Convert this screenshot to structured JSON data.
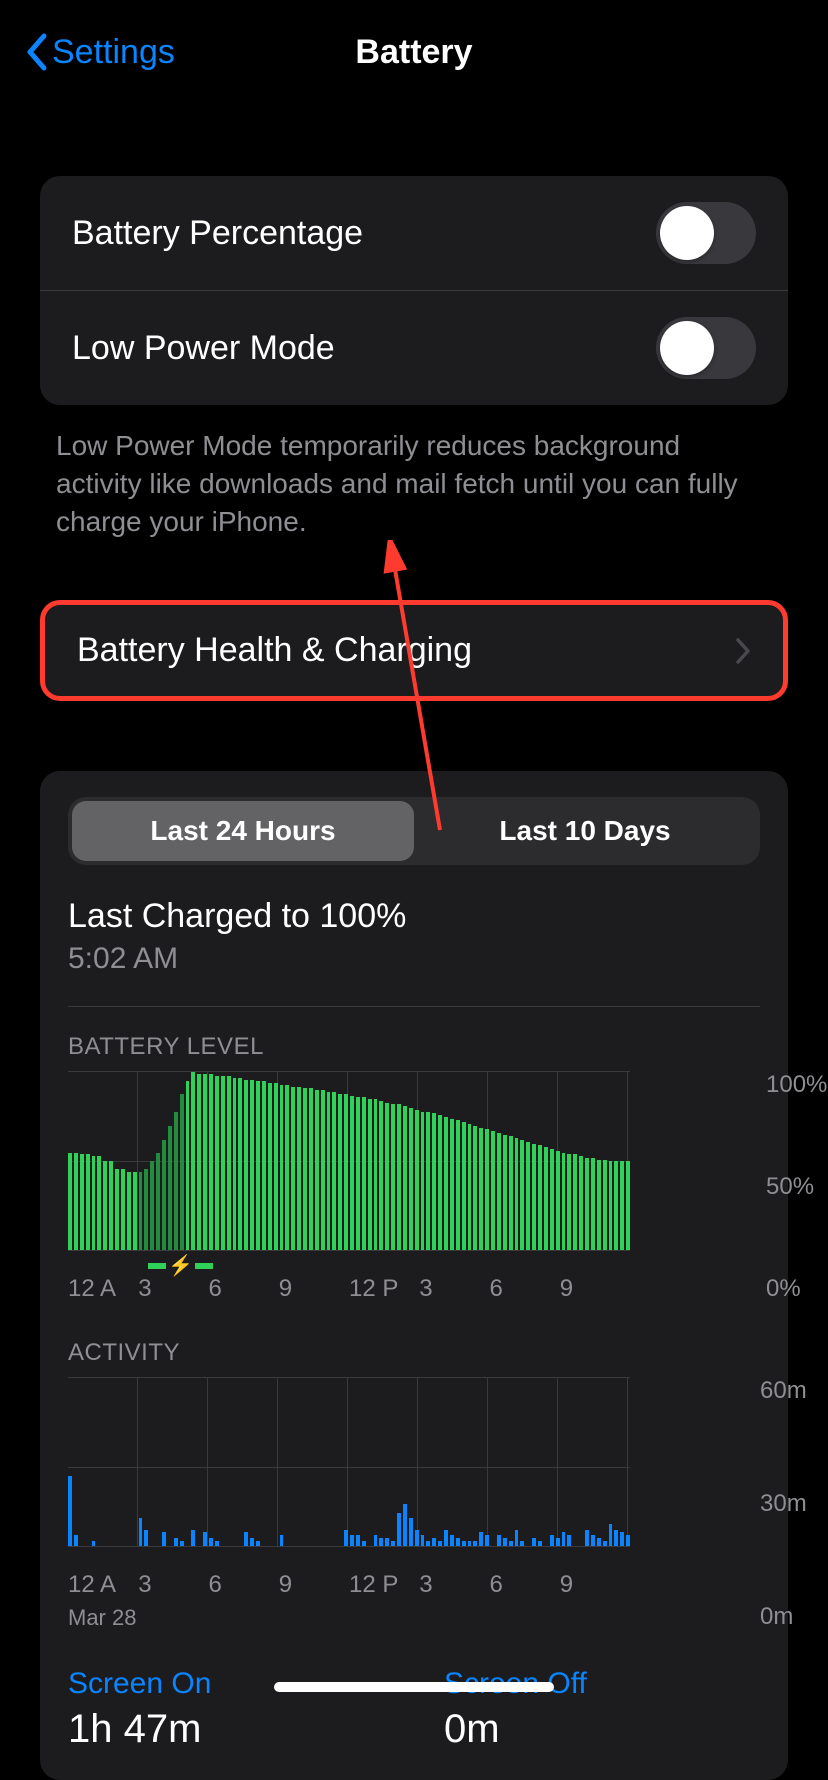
{
  "header": {
    "back_label": "Settings",
    "title": "Battery"
  },
  "toggles": {
    "battery_percentage": {
      "label": "Battery Percentage",
      "on": false
    },
    "low_power_mode": {
      "label": "Low Power Mode",
      "on": false
    },
    "note": "Low Power Mode temporarily reduces background activity like downloads and mail fetch until you can fully charge your iPhone."
  },
  "health": {
    "label": "Battery Health & Charging"
  },
  "segmented": {
    "a": "Last 24 Hours",
    "b": "Last 10 Days"
  },
  "last_charged": {
    "title": "Last Charged to 100%",
    "time": "5:02 AM"
  },
  "battery_level": {
    "label": "BATTERY LEVEL",
    "y": {
      "top": "100%",
      "mid": "50%",
      "bot": "0%"
    }
  },
  "activity": {
    "label": "ACTIVITY",
    "y": {
      "top": "60m",
      "mid": "30m",
      "bot": "0m"
    },
    "date": "Mar 28"
  },
  "x_ticks": [
    "12 A",
    "3",
    "6",
    "9",
    "12 P",
    "3",
    "6",
    "9"
  ],
  "screen": {
    "on_label": "Screen On",
    "on_value": "1h 47m",
    "off_label": "Screen Off",
    "off_value": "0m"
  },
  "chart_data": [
    {
      "type": "bar",
      "title": "BATTERY LEVEL",
      "ylabel": "Percent",
      "ylim": [
        0,
        100
      ],
      "x_ticks": [
        "12 A",
        "3",
        "6",
        "9",
        "12 P",
        "3",
        "6",
        "9"
      ],
      "charging_range_hours": [
        3,
        5
      ],
      "values": [
        55,
        55,
        54,
        54,
        53,
        53,
        50,
        50,
        46,
        46,
        44,
        44,
        44,
        46,
        50,
        55,
        62,
        70,
        78,
        88,
        95,
        100,
        99,
        99,
        99,
        98,
        98,
        98,
        97,
        97,
        96,
        96,
        95,
        95,
        94,
        94,
        93,
        93,
        92,
        92,
        91,
        91,
        90,
        90,
        89,
        89,
        88,
        88,
        87,
        86,
        86,
        85,
        85,
        84,
        83,
        82,
        82,
        81,
        80,
        79,
        78,
        78,
        77,
        76,
        75,
        74,
        73,
        72,
        71,
        70,
        69,
        68,
        67,
        66,
        65,
        64,
        63,
        62,
        61,
        60,
        59,
        58,
        57,
        56,
        55,
        54,
        54,
        53,
        52,
        52,
        51,
        51,
        50,
        50,
        50,
        50
      ]
    },
    {
      "type": "bar",
      "title": "ACTIVITY",
      "ylabel": "Minutes",
      "ylim": [
        0,
        60
      ],
      "x_ticks": [
        "12 A",
        "3",
        "6",
        "9",
        "12 P",
        "3",
        "6",
        "9"
      ],
      "values": [
        25,
        4,
        0,
        0,
        2,
        0,
        0,
        0,
        0,
        0,
        0,
        0,
        10,
        6,
        0,
        0,
        5,
        0,
        3,
        2,
        0,
        6,
        0,
        5,
        3,
        2,
        0,
        0,
        0,
        0,
        5,
        3,
        2,
        0,
        0,
        0,
        4,
        0,
        0,
        0,
        0,
        0,
        0,
        0,
        0,
        0,
        0,
        6,
        4,
        4,
        2,
        0,
        4,
        3,
        3,
        2,
        12,
        15,
        10,
        6,
        4,
        2,
        3,
        2,
        6,
        4,
        3,
        2,
        2,
        2,
        5,
        4,
        0,
        4,
        3,
        2,
        6,
        2,
        0,
        3,
        2,
        0,
        4,
        3,
        5,
        4,
        0,
        0,
        6,
        4,
        3,
        2,
        8,
        6,
        5,
        4
      ]
    }
  ]
}
